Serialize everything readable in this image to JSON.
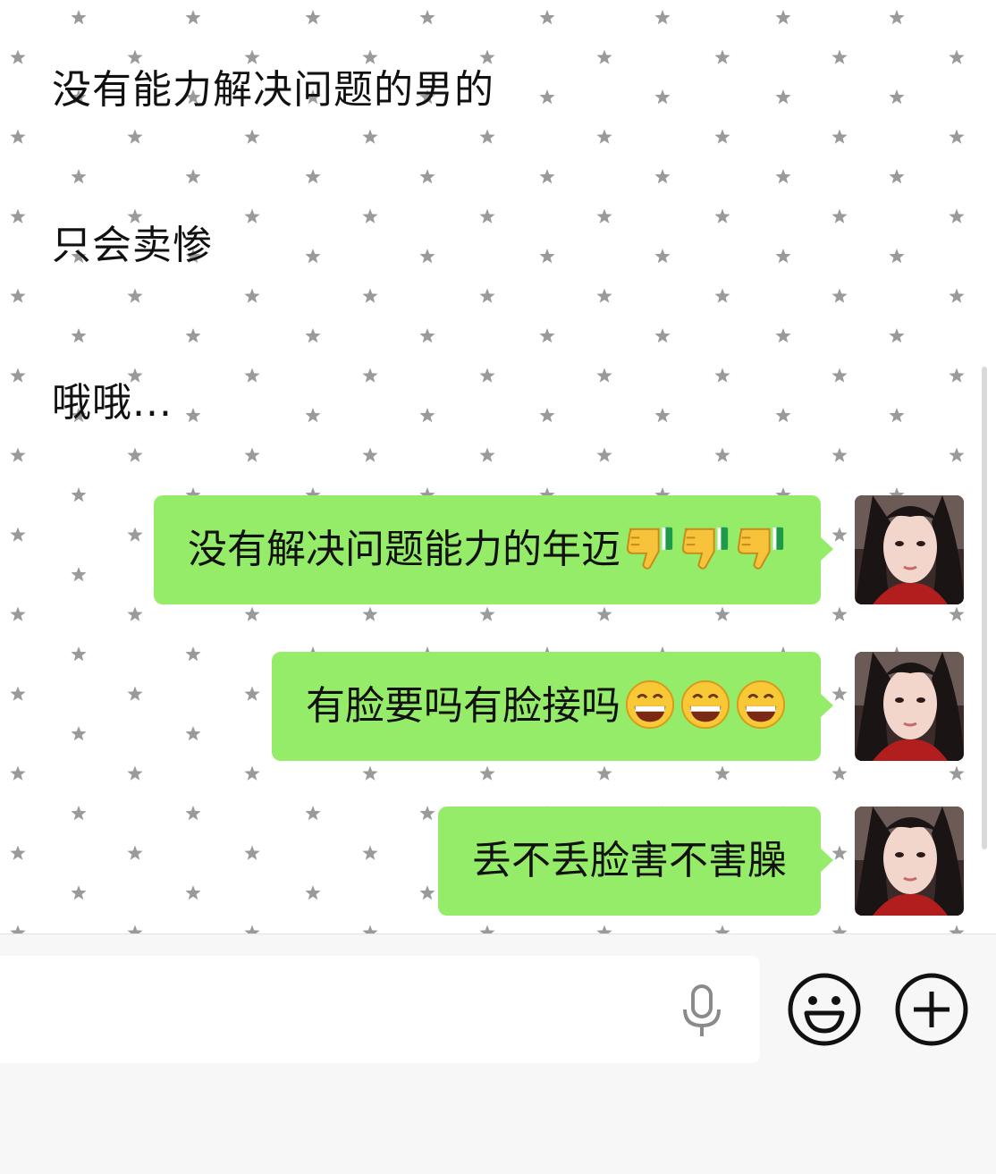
{
  "messages_received": [
    {
      "text": "没有能力解决问题的男的"
    },
    {
      "text": "只会卖惨"
    },
    {
      "text": "哦哦..."
    }
  ],
  "messages_sent": [
    {
      "text": "没有解决问题能力的年迈",
      "emoji": "thumbs-down-icon",
      "emoji_count": 3
    },
    {
      "text": "有脸要吗有脸接吗",
      "emoji": "grinning-face-icon",
      "emoji_count": 3
    },
    {
      "text": "丢不丢脸害不害臊",
      "emoji": "",
      "emoji_count": 0
    }
  ],
  "colors": {
    "sent_bubble": "#95ec69",
    "input_bar_bg": "#f6f7f6",
    "text": "#111111"
  },
  "input": {
    "value": "",
    "placeholder": ""
  },
  "icons": {
    "voice": "microphone-icon",
    "emoji": "smiley-face-icon",
    "more": "plus-circle-icon"
  }
}
